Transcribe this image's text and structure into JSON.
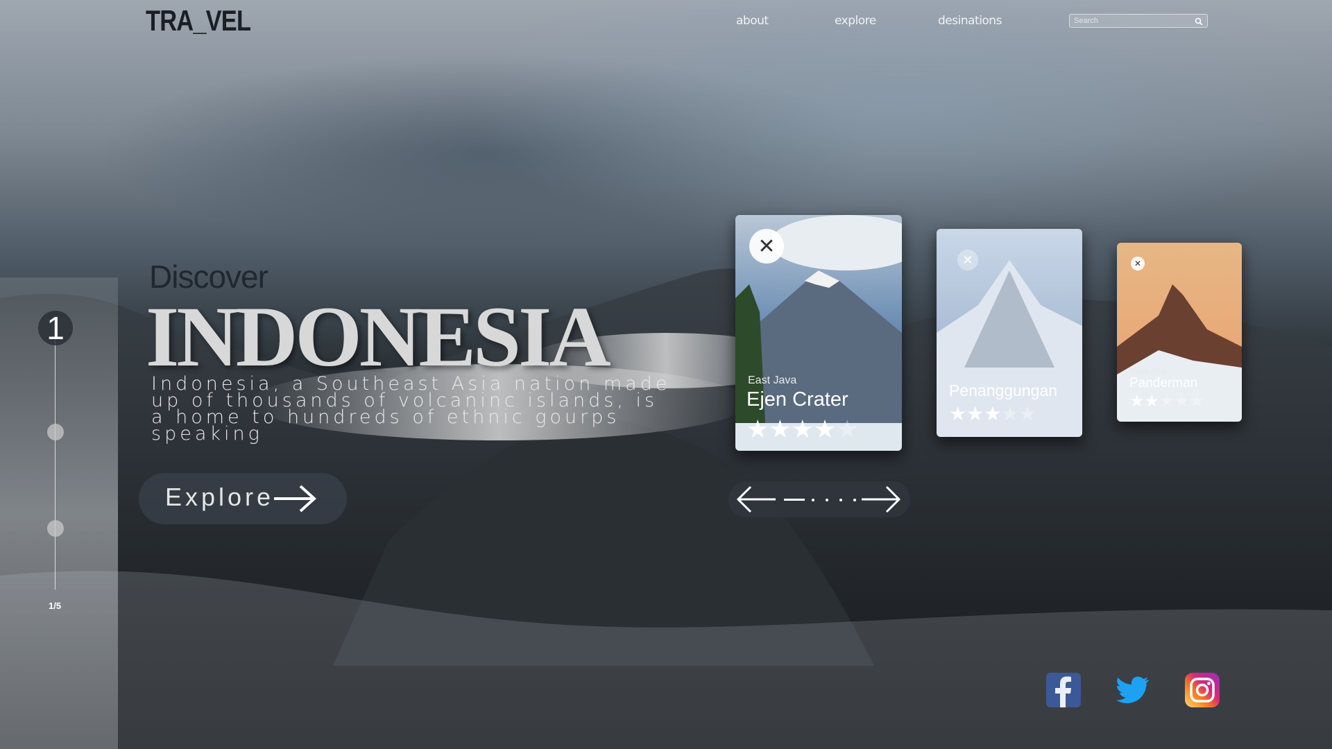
{
  "header": {
    "logo": "TRA_VEL",
    "nav": [
      {
        "label": "about"
      },
      {
        "label": "explore"
      },
      {
        "label": "desinations"
      }
    ],
    "search_placeholder": "Search"
  },
  "slider": {
    "current": "1",
    "counter": "1/5"
  },
  "hero": {
    "discover": "Discover",
    "title": "INDONESIA",
    "description": "Indonesia, a Southeast Asia nation made up of thousands of volcaninc islands, is a home to hundreds of ethnic gourps speaking",
    "explore_label": "Explore"
  },
  "cards": [
    {
      "region": "East Java",
      "name": "Ejen Crater",
      "rating": 4.5
    },
    {
      "region": "",
      "name": "Penanggungan",
      "rating": 3.5
    },
    {
      "region": "East Java",
      "name": "Panderman",
      "rating": 2
    }
  ],
  "carousel": {
    "pages": 5,
    "current": 1
  },
  "social": [
    {
      "icon": "facebook-icon",
      "color": "#3b5998"
    },
    {
      "icon": "twitter-icon",
      "color": "#1da1f2"
    },
    {
      "icon": "instagram-icon",
      "color": "#e1306c"
    }
  ],
  "colors": {
    "accent": "#ffffff",
    "dark_text": "#20272f"
  }
}
